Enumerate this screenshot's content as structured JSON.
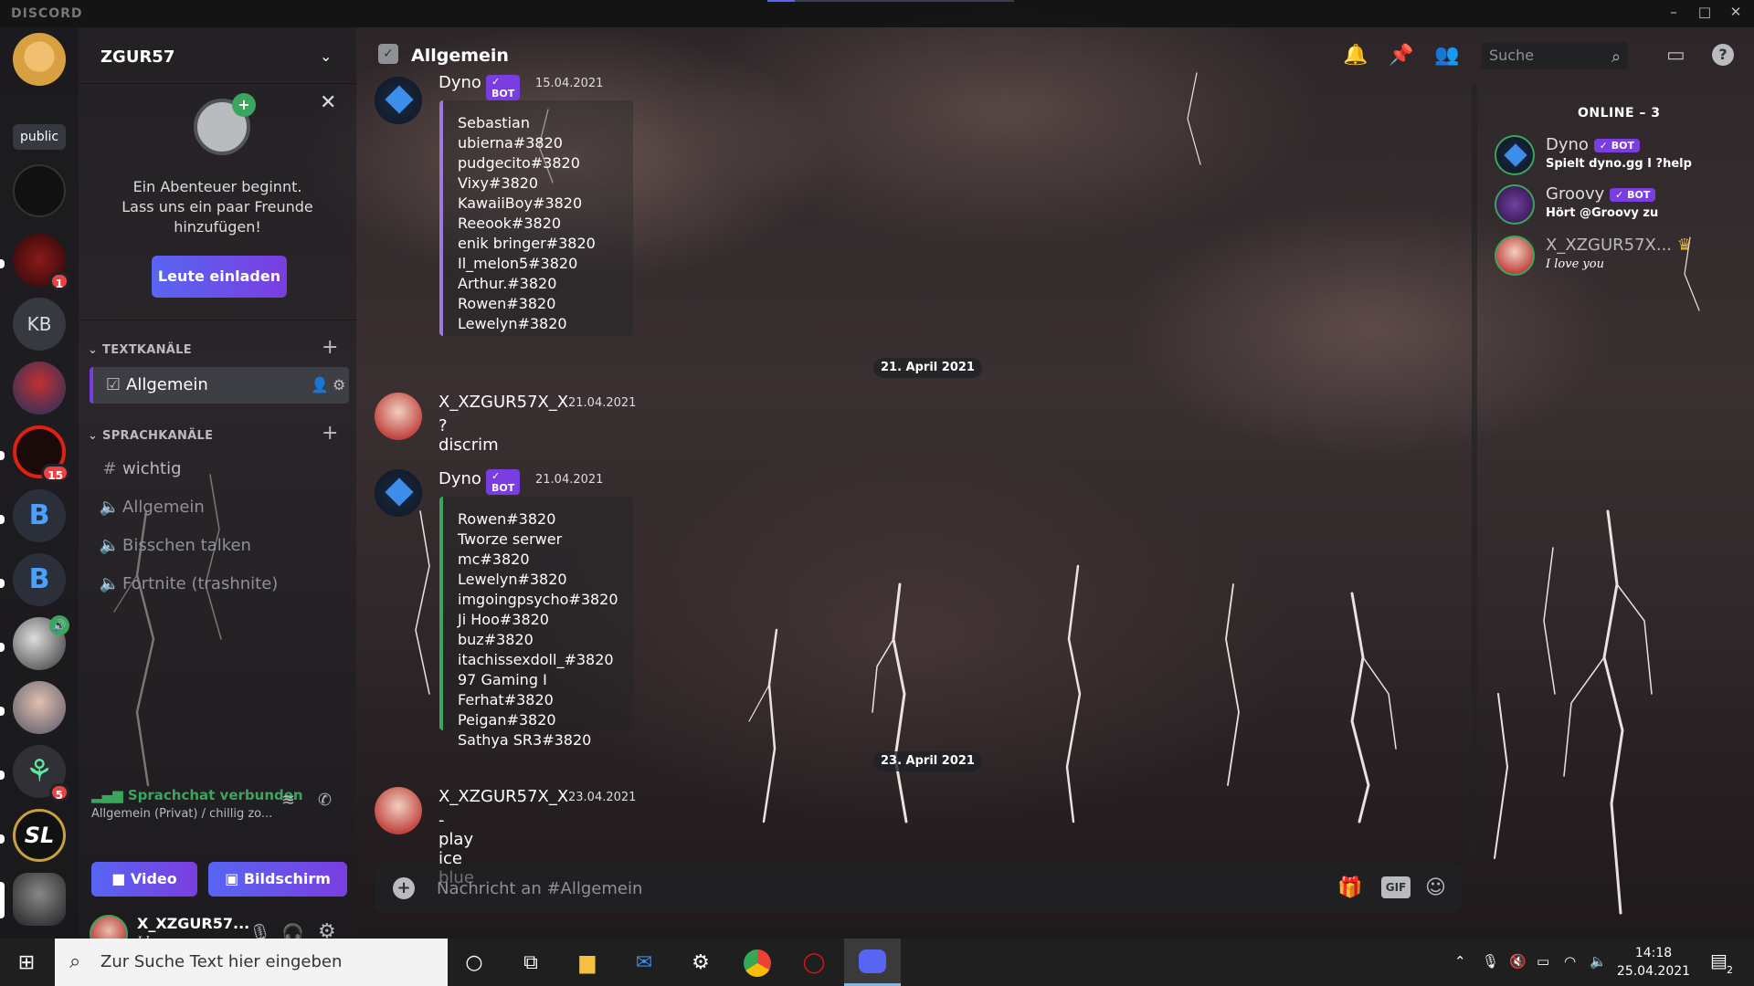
{
  "app": {
    "brand": "DISCORD",
    "window_controls": [
      "–",
      "□",
      "✕"
    ]
  },
  "guilds": {
    "home_tooltip": "public",
    "initials": "KB",
    "badges": {
      "g1": "1",
      "g2": "15",
      "g3": "5"
    },
    "add_label": "+"
  },
  "server": {
    "name": "ZGUR57",
    "invite": {
      "text_line1": "Ein Abenteuer beginnt.",
      "text_line2": "Lass uns ein paar Freunde",
      "text_line3": "hinzufügen!",
      "button": "Leute einladen"
    },
    "categories": {
      "text": "TEXTKANÄLE",
      "voice": "SPRACHKANÄLE"
    },
    "text_channels": [
      {
        "name": "Allgemein"
      }
    ],
    "voice_channels": [
      {
        "name": "wichtig"
      },
      {
        "name": "Allgemein"
      },
      {
        "name": "Bisschen talken"
      },
      {
        "name": "Fortnite (trashnite)"
      }
    ]
  },
  "voice": {
    "status": "Sprachchat verbunden",
    "channel": "Allgemein (Privat) / chillig zo...",
    "video_label": "Video",
    "screen_label": "Bildschirm"
  },
  "user": {
    "name": "X_XZGUR57...",
    "status": "I love you"
  },
  "chat": {
    "channel": "Allgemein",
    "search_placeholder": "Suche",
    "composer_placeholder": "Nachricht an #Allgemein",
    "gif_label": "GIF",
    "messages": [
      {
        "author": "Dyno",
        "bot_tag": "✓ BOT",
        "time": "15.04.2021",
        "embed": [
          "Sebastian ubierna#3820",
          "pudgecito#3820",
          "Vixy#3820",
          "KawaiiBoy#3820",
          "Reeook#3820",
          "enik bringer#3820",
          "Il_melon5#3820",
          "Arthur.#3820",
          "Rowen#3820",
          "Lewelyn#3820"
        ]
      },
      {
        "author": "X_XZGUR57X_X",
        "time": "21.04.2021",
        "text": "?discrim"
      },
      {
        "author": "Dyno",
        "bot_tag": "✓ BOT",
        "time": "21.04.2021",
        "embed": [
          "Rowen#3820",
          "Tworze serwer mc#3820",
          "Lewelyn#3820",
          "imgoingpsycho#3820",
          "Ji Hoo#3820",
          "buz#3820",
          "itachissexdoll_#3820",
          "97 Gaming I Ferhat#3820",
          "Peigan#3820",
          "Sathya SR3#3820"
        ]
      },
      {
        "author": "X_XZGUR57X_X",
        "time": "23.04.2021",
        "text": "-play ice blue"
      }
    ],
    "dividers": [
      "21. April 2021",
      "23. April 2021"
    ]
  },
  "members": {
    "heading": "ONLINE – 3",
    "list": [
      {
        "name": "Dyno",
        "bot_tag": "✓ BOT",
        "status": "Spielt dyno.gg I ?help",
        "color": "#ffffff"
      },
      {
        "name": "Groovy",
        "bot_tag": "✓ BOT",
        "status": "Hört @Groovy zu",
        "color": "#ffffff"
      },
      {
        "name": "X_XZGUR57X...",
        "status": "I love you",
        "color": "#dcddde"
      }
    ]
  },
  "taskbar": {
    "search_placeholder": "Zur Suche Text hier eingeben",
    "time": "14:18",
    "date": "25.04.2021",
    "notif_count": "2"
  },
  "colors": {
    "accent": "#5865f2",
    "bot_purple": "#7a3ee0",
    "online_green": "#3ba55d",
    "mention_red": "#ed4245"
  }
}
